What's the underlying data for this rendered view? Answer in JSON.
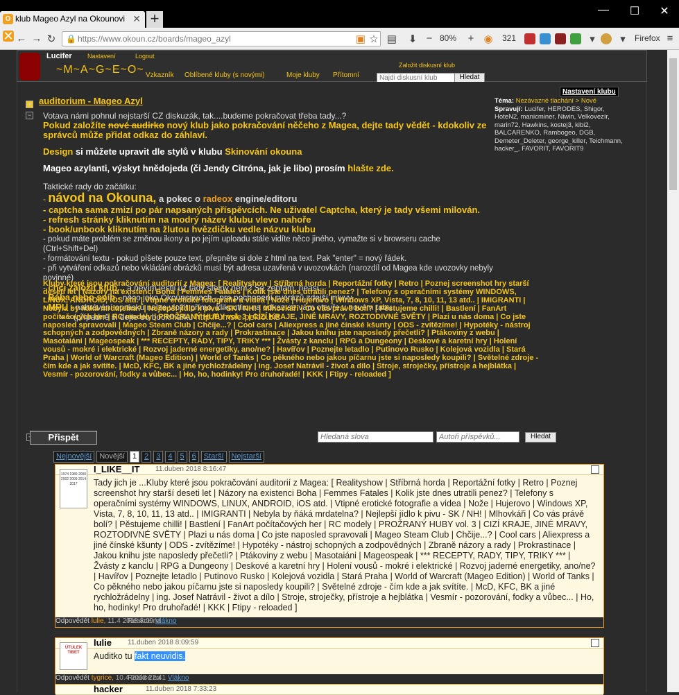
{
  "browser": {
    "tab_title": "klub Mageo Azyl na Okounovi",
    "url": "https://www.okoun.cz/boards/mageo_azyl",
    "zoom": "80%",
    "counter": "321",
    "app_name": "Firefox"
  },
  "header": {
    "username": "Lucifer",
    "settings_link": "Nastavení",
    "logout_link": "Logout",
    "logo": "~M~A~G~E~O~",
    "nav": [
      "Vzkazník",
      "Oblíbené kluby  (s novými)",
      "Moje kluby",
      "Přítomní"
    ],
    "create_club": "Založit diskusní klub",
    "search_placeholder": "Najdi diskusní klub",
    "search_button": "Hledat"
  },
  "board": {
    "title": "auditorium - Mageo Azyl",
    "line1": "Votava námi pohnul nejstarší CZ diskuzák, tak....budeme pokračovat třeba tady...?",
    "line2a": "Pokud založíte ",
    "line2strike": "nové audirko",
    "line2b": " nový klub jako pokračování něčeho z Magea, dejte tady vědět - kdokoliv ze správců může přidat odkaz do záhlaví.",
    "design_a": "Design",
    "design_b": " si můžete upravit dle stylů v klubu ",
    "design_c": "Skinování okouna",
    "azyl_a": "Mageo azylanti, výskyt hnědojeda (či Jendy Citróna, jak je libo) prosím ",
    "azyl_b": "hlašte zde.",
    "tips_title": "Taktické rady do začátku:",
    "tip1a": "návod na Okouna,",
    "tip1b": " a pokec o ",
    "tip1c": "radeox",
    "tip1d": " engine/editoru",
    "tip2": "- captcha sama zmizí po pár napsaných příspěvcích. Ne uživatel Captcha, který je tady všemi milován.",
    "tip3": "- refresh stránky kliknutím na modrý název klubu vlevo nahoře",
    "tip4": "- book/unbook kliknutím na žlutou hvězdičku vedle názvu klubu",
    "tip5": "- pokud máte problém se změnou ikony a po jejím uploadu stále vidíte něco jiného, vymažte si v browseru cache (Ctrl+Shift+Del)",
    "tip6": "- formátování textu - pokud píšete pouze text, přepněte si dole z html na text. Pak \"enter\" = nový řádek.",
    "tip7": "- při vytváření odkazů nebo vkládání obrázků musí být adresa uzavřená v uvozovkách (narozdíl od Magea kde uvozovky nebyly povinné)",
    "tip8a": "chci založit klub...",
    "tip8b": " a nevím jestli už tady stejný není? Se zeptám, neasi.",
    "tip9a": "Bába nebo sníh",
    "tip9b": " - něco jako Okounspeach - pro pochopení svérázů zdejší mluvy",
    "tip10a": "MPU",
    "tip10b": " - nahrávání oprásků nelze vložit přímo, kliknutím na odkaz se vám otevře v novém tabu",
    "tip11a": "» » (případně si dejte do bookmarku ",
    "tip11b": "http://umsle.peklo.biz",
    "clubs_text": "Kluby které jsou pokračování auditorií z Magea: [ Realityshow | Stříbrná horda | Reportážní fotky | Retro | Poznej screenshot hry starší deseti let | Názory na existenci Boha | Femmes Fatales | Kolik jste dnes utratili penez? | Telefony s operačními systémy WINDOWS, LINUX, ANDROID, iOS atd. | Vtipné erotické fotografie a videa | Nože | Hujerovo | Windows XP, Vista, 7, 8, 10, 11, 13 atd.. | IMIGRANTI | Nebyla by ňáká mrdatelna? | Nejlepší jídlo k pivu - SK / NH! | Mlhovkáři | Co vás právě bolí? | Pěstujeme chilli! | Bastlení | FanArt počítačových her | RC modely | PROŽRANÝ HUBY vol. 3 | CIZÍ KRAJE, JINÉ MRAVY, ROZTODIVNÉ SVĚTY | Plazi u nás doma | Co jste naposled spravovali | Mageo Steam Club | Chčije...? | Cool cars | Aliexpress a jiné čínské kšunty | ODS - zvítězíme! | Hypotéky - nástroj schopných a zodpovědných | Zbraně názory a rady | Prokrastinace | Jakou knihu jste naposledy přečetli? | Ptákoviny z webu | Masotaiáni | Mageospeak | *** RECEPTY, RADY, TIPY, TRIKY *** | Žvásty z kanclu | RPG a Dungeony | Deskové a karetní hry | Holení vousů - mokré i elektrické | Rozvoj jaderné energetiky, ano/ne? | Havířov | Poznejte letadlo | Putinovo Rusko | Kolejová vozidla | Stará Praha | World of Warcraft (Mageo Edition) | World of Tanks | Co pěkného nebo jakou píčarnu jste si naposledy koupili? | Světelné zdroje - čím kde a jak svítíte. | McD, KFC, BK a jiné rychložrádelny | ing. Josef Natrávil - život a dílo | Stroje, stroječky, přístroje a hejblátka | Vesmír - pozorování, fodky a vůbec... | Ho, ho, hodinky! Pro druhořadé! | KKK | Ftipy - reloaded ]"
  },
  "sidebar": {
    "settings": "Nastavení klubu",
    "tema_label": "Téma:",
    "tema_value": "Nezávazné tlachání > Nové",
    "admins_label": "Spravují:",
    "admins": "Lucifer, HERODES, Shigor, HoteN2, manicminer, Niwin, Velkovezír, marin72, Hawkins, kostej3, kibi2, BALCARENKO, Rambogeo, DGB, Demeter_Deleter, george_killer, Teichmann, hacker_, FAVORIT, FAVORIT9"
  },
  "actions": {
    "post_button": "Přispět",
    "search_words_placeholder": "Hledaná slova",
    "search_authors_placeholder": "Autoři příspěvků...",
    "search_button": "Hledat"
  },
  "pager": {
    "newest": "Nejnovější",
    "newer": "Novější",
    "pages": [
      "1",
      "2",
      "3",
      "4",
      "5",
      "6"
    ],
    "older": "Starší",
    "oldest": "Nejstarší"
  },
  "posts": [
    {
      "author": "I_LIKE__IT",
      "date": "11.duben 2018 8:16:47",
      "avatar_text": "1974 1989 2000 2002 2009 2014 2017",
      "body": "Tady jich je ...Kluby které jsou pokračování auditorií z Magea: [ Realityshow | Stříbrná horda | Reportážní fotky | Retro | Poznej screenshot hry starší deseti let | Názory na existenci Boha | Femmes Fatales | Kolik jste dnes utratili penez? | Telefony s operačními systémy WINDOWS, LINUX, ANDROID, iOS atd. | Vtipné erotické fotografie a videa | Nože | Hujerovo | Windows XP, Vista, 7, 8, 10, 11, 13 atd.. | IMIGRANTI | Nebyla by ňáká mrdatelna? | Nejlepší jídlo k pivu - SK / NH! | Mlhovkáři | Co vás právě bolí? | Pěstujeme chilli! | Bastlení | FanArt počítačových her | RC modely | PROŽRANÝ HUBY vol. 3 | CIZÍ KRAJE, JINÉ MRAVY, ROZTODIVNÉ SVĚTY | Plazi u nás doma | Co jste naposled spravovali | Mageo Steam Club | Chčije...? | Cool cars | Aliexpress a jiné čínské kšunty | ODS - zvítězíme! | Hypotéky - nástroj schopných a zodpovědných | Zbraně názory a rady | Prokrastinace | Jakou knihu jste naposledy přečetli? | Ptákoviny z webu | Masotaiáni | Mageospeak | *** RECEPTY, RADY, TIPY, TRIKY *** | Žvásty z kanclu | RPG a Dungeony | Deskové a karetní hry | Holení vousů - mokré i elektrické | Rozvoj jaderné energetiky, ano/ne? | Havířov | Poznejte letadlo | Putinovo Rusko | Kolejová vozidla | Stará Praha | World of Warcraft (Mageo Edition) | World of Tanks | Co pěkného nebo jakou píčarnu jste si naposledy koupili? | Světelné zdroje - čím kde a jak svítíte. | McD, KFC, BK a jiné rychložrádelny | ing. Josef Natrávil - život a dílo | Stroje, stroječky, přístroje a hejblátka | Vesmír - pozorování, fodky a vůbec... | Ho, ho, hodinky! Pro druhořadé! | KKK | Ftipy - reloaded ]",
      "reply": "Odpovědět",
      "reaction_label": "Reakce na",
      "reaction_to": "lulie,",
      "reaction_date": "11.4 2018 8:09",
      "thread": "Vlákno"
    },
    {
      "author": "lulie",
      "date": "11.duben 2018 8:09:59",
      "avatar_text": "ÚTULEK TIBET",
      "body_a": "Auditko tu ",
      "body_b": "fakt neuvidis.",
      "reply": "Odpovědět",
      "reaction_label": "Reakce na",
      "reaction_to": "tygrice,",
      "reaction_date": "10.4 2018 22:41",
      "thread": "Vlákno"
    },
    {
      "author": "hacker",
      "date": "11.duben 2018 7:33:23"
    }
  ],
  "colors": {
    "accent_yellow": "#f5c518",
    "orange": "#f0a020",
    "background": "#2b2b2b",
    "post_bg": "#fff8e0",
    "selection": "#3390ff"
  }
}
